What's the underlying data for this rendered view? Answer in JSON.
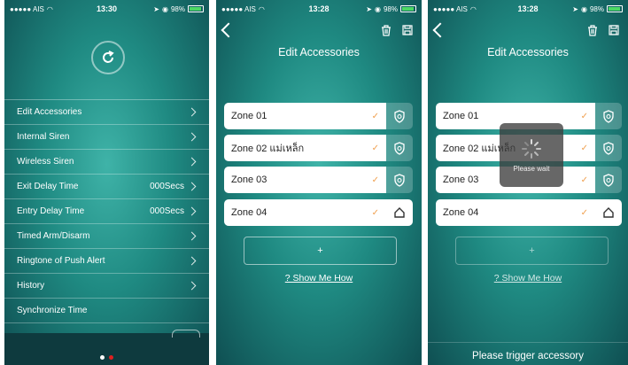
{
  "screen1": {
    "status": {
      "carrier": "●●●●● AIS",
      "time": "13:30",
      "battery": "98%"
    },
    "menu": [
      {
        "label": "Edit Accessories",
        "value": ""
      },
      {
        "label": "Internal Siren",
        "value": ""
      },
      {
        "label": "Wireless Siren",
        "value": ""
      },
      {
        "label": "Exit Delay Time",
        "value": "000Secs"
      },
      {
        "label": "Entry Delay Time",
        "value": "000Secs"
      },
      {
        "label": "Timed Arm/Disarm",
        "value": ""
      },
      {
        "label": "Ringtone of Push Alert",
        "value": ""
      },
      {
        "label": "History",
        "value": ""
      },
      {
        "label": "Synchronize Time",
        "value": ""
      }
    ]
  },
  "screen2": {
    "status": {
      "carrier": "●●●●● AIS",
      "time": "13:28",
      "battery": "98%"
    },
    "title": "Edit Accessories",
    "zones": [
      {
        "name": "Zone 01",
        "icon": "shield-icon"
      },
      {
        "name": "Zone 02 แม่เหล็ก",
        "icon": "shield-icon"
      },
      {
        "name": "Zone 03",
        "icon": "shield-icon"
      },
      {
        "name": "Zone 04",
        "icon": "home-icon"
      }
    ],
    "add_label": "+",
    "help_link": "? Show Me How"
  },
  "screen3": {
    "status": {
      "carrier": "●●●●● AIS",
      "time": "13:28",
      "battery": "98%"
    },
    "title": "Edit Accessories",
    "zones": [
      {
        "name": "Zone 01",
        "icon": "shield-icon"
      },
      {
        "name": "Zone 02 แม่เหล็ก",
        "icon": "shield-icon"
      },
      {
        "name": "Zone 03",
        "icon": "shield-icon"
      },
      {
        "name": "Zone 04",
        "icon": "home-icon"
      }
    ],
    "add_label": "+",
    "help_link": "? Show Me How",
    "wait_text": "Please wait",
    "footer": "Please trigger accessory"
  },
  "colors": {
    "accent": "#1f8a82",
    "check": "#f0a050",
    "page_dot_active": "#e02020"
  }
}
